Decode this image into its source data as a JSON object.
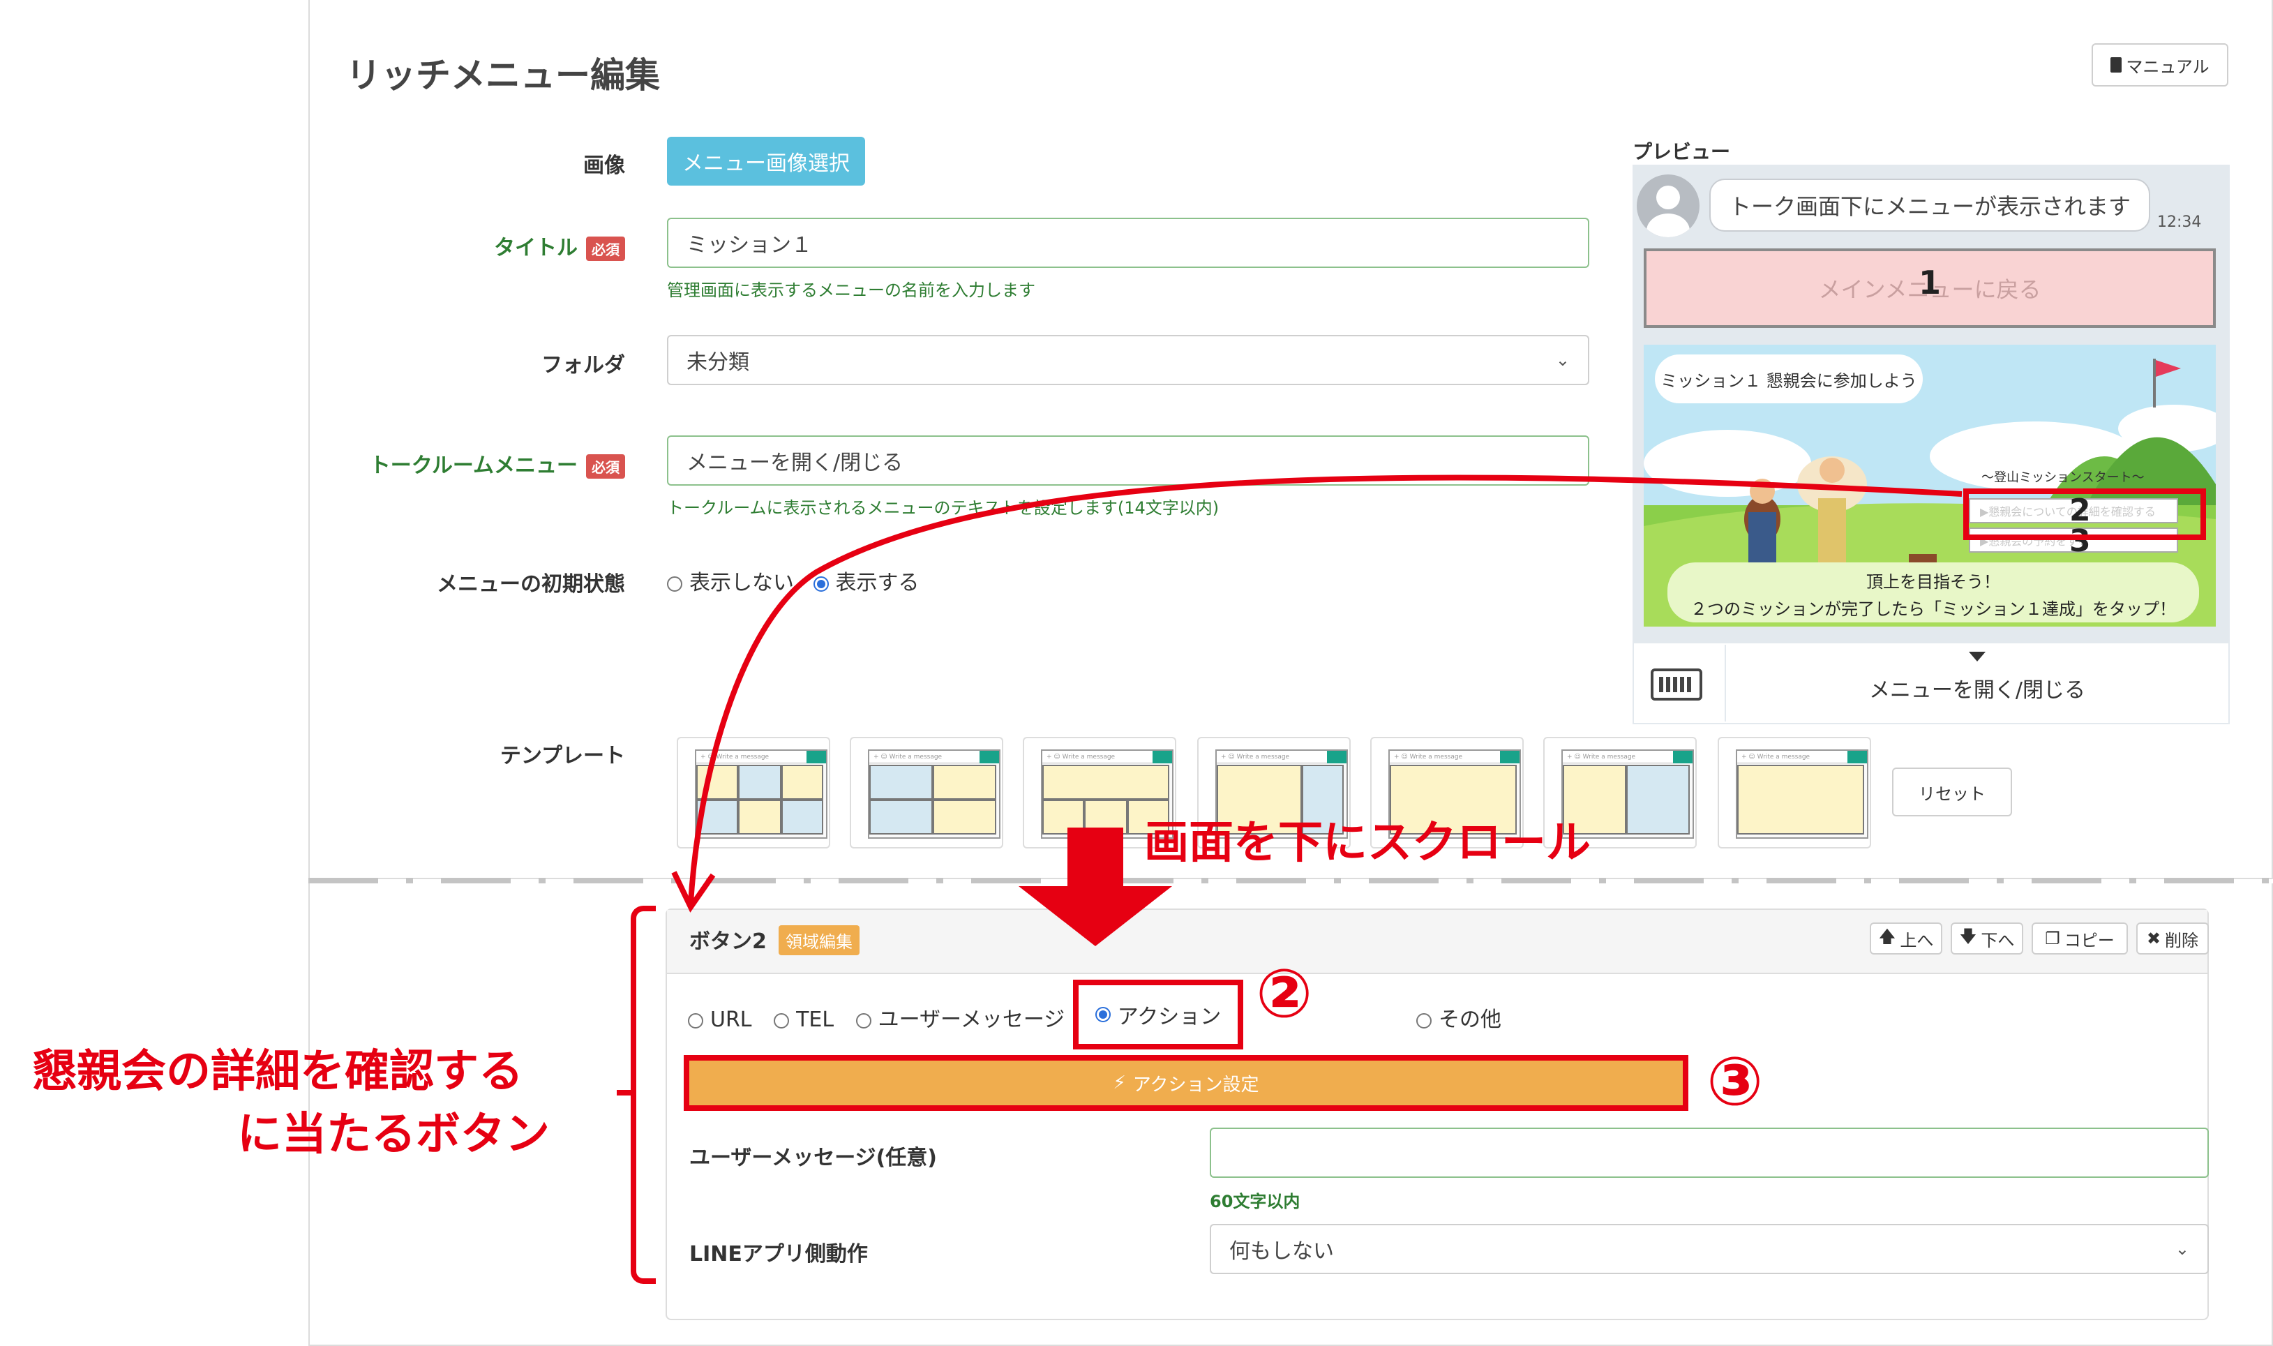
{
  "page": {
    "title": "リッチメニュー編集",
    "manual_label": "マニュアル"
  },
  "form": {
    "image_label": "画像",
    "image_button": "メニュー画像選択",
    "title_label": "タイトル",
    "required_badge": "必須",
    "title_value": "ミッション１",
    "title_help": "管理画面に表示するメニューの名前を入力します",
    "folder_label": "フォルダ",
    "folder_value": "未分類",
    "talk_label": "トークルームメニュー",
    "talk_value": "メニューを開く/閉じる",
    "talk_help": "トークルームに表示されるメニューのテキストを設定します(14文字以内)",
    "initial_label": "メニューの初期状態",
    "initial_options": [
      "表示しない",
      "表示する"
    ],
    "template_label": "テンプレート",
    "reset_label": "リセット",
    "template_bar_text": "Write a message"
  },
  "preview": {
    "label": "プレビュー",
    "chat_text": "トーク画面下にメニューが表示されます",
    "time": "12:34",
    "main_menu_text": "メインメニューに戻る",
    "banner_title": "ミッション１ 懇親会に参加しよう",
    "mission_start": "～登山ミッションスタート～",
    "link1": "▶懇親会についての詳細を確認する",
    "link2": "▶懇親会の予約をする",
    "bottom1": "頂上を目指そう！",
    "bottom2": "２つのミッションが完了したら「ミッション１達成」をタップ！",
    "toggle_text": "メニューを開く/閉じる",
    "num1": "1",
    "num2": "2",
    "num3": "3"
  },
  "button_panel": {
    "title": "ボタン2",
    "area_badge": "領域編集",
    "up": "上へ",
    "down": "下へ",
    "copy": "コピー",
    "delete": "削除",
    "types": [
      "URL",
      "TEL",
      "ユーザーメッセージ",
      "アクション",
      "その他"
    ],
    "selected_type": "アクション",
    "action_button": "アクション設定",
    "user_msg_label": "ユーザーメッセージ(任意)",
    "user_msg_value": "",
    "user_msg_help": "60文字以内",
    "line_label": "LINEアプリ側動作",
    "line_value": "何もしない"
  },
  "annotations": {
    "scroll_text": "画面を下にスクロール",
    "side_line1": "懇親会の詳細を確認する",
    "side_line2": "に当たるボタン",
    "step2": "②",
    "step3": "③"
  },
  "colors": {
    "accent_red": "#e60012",
    "image_button": "#5bc0de",
    "action_button": "#f0ad4e",
    "label_green": "#2e7d32",
    "required": "#d9534f"
  }
}
